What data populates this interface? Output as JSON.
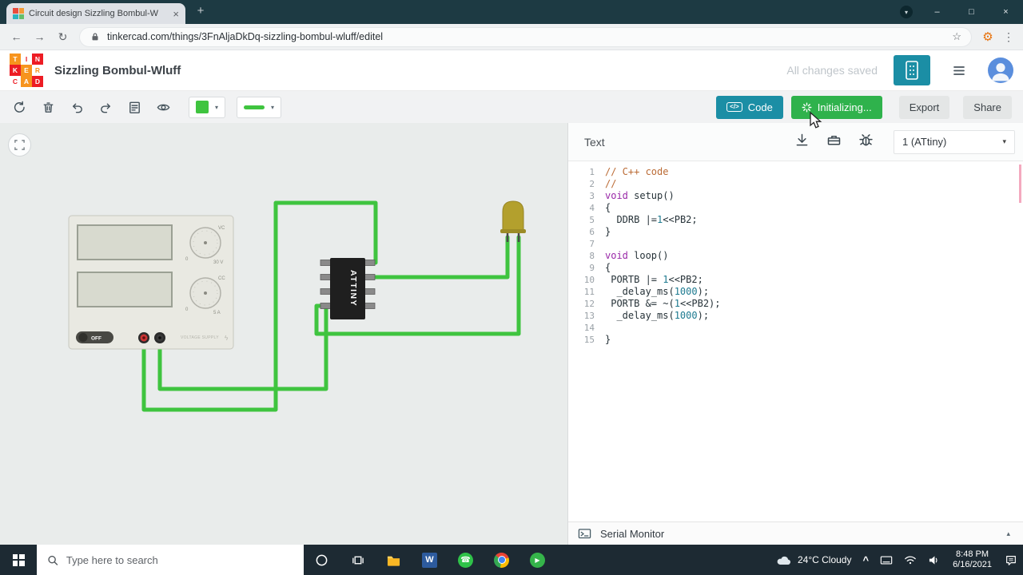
{
  "colors": {
    "accent_teal": "#1b8ea5",
    "run_green": "#2fb24c",
    "wire_green": "#3fc43f",
    "titlebar_bg": "#1d3a43",
    "taskbar_bg": "#1d2a33"
  },
  "glyphs": {
    "caret_down": "▾",
    "caret_up": "▴",
    "close": "×",
    "plus": "+",
    "minimize": "–",
    "maximize": "□",
    "back": "←",
    "forward": "→",
    "reload": "↻",
    "star": "☆",
    "gear": "⚙",
    "menu_dots": "⋮",
    "chevron": "^",
    "phone": "☎",
    "play": "▶",
    "bolt": "ϟ",
    "code_tag": "</>"
  },
  "browser": {
    "tab_title": "Circuit design Sizzling Bombul-W",
    "url": "tinkercad.com/things/3FnAljaDkDq-sizzling-bombul-wluff/editel"
  },
  "header": {
    "logo_cells": [
      {
        "ch": "T",
        "bg": "#f7941e",
        "fg": "#ffffff"
      },
      {
        "ch": "I",
        "bg": "#ffffff",
        "fg": "#ed1c24"
      },
      {
        "ch": "N",
        "bg": "#ed1c24",
        "fg": "#ffffff"
      },
      {
        "ch": "K",
        "bg": "#ed1c24",
        "fg": "#ffffff"
      },
      {
        "ch": "E",
        "bg": "#f7941e",
        "fg": "#ffffff"
      },
      {
        "ch": "R",
        "bg": "#ffffff",
        "fg": "#f7941e"
      },
      {
        "ch": "C",
        "bg": "#ffffff",
        "fg": "#ed1c24"
      },
      {
        "ch": "A",
        "bg": "#f7941e",
        "fg": "#ffffff"
      },
      {
        "ch": "D",
        "bg": "#ed1c24",
        "fg": "#ffffff"
      }
    ],
    "title": "Sizzling Bombul-Wluff",
    "status": "All changes saved"
  },
  "toolbar": {
    "code": "Code",
    "run": "Initializing...",
    "export": "Export",
    "share": "Share"
  },
  "canvas": {
    "chip": "ATTINY",
    "psu": {
      "off": "OFF",
      "vc": "VC",
      "cc": "CC",
      "v_max": "30 V",
      "a_max": "5 A",
      "zero": "0",
      "brand": "VOLTAGE SUPPLY"
    }
  },
  "code_panel": {
    "mode": "Text",
    "board": "1 (ATtiny)",
    "serial": "Serial Monitor",
    "lines": [
      "// C++ code",
      "//",
      "void setup()",
      "{",
      "  DDRB |=1<<PB2;",
      "}",
      "",
      "void loop()",
      "{",
      " PORTB |= 1<<PB2;",
      "  _delay_ms(1000);",
      " PORTB &= ~(1<<PB2);",
      "  _delay_ms(1000);",
      "",
      "}"
    ]
  },
  "taskbar": {
    "search": "Type here to search",
    "word_letter": "W",
    "weather": "24°C Cloudy",
    "time": "8:48 PM",
    "date": "6/16/2021"
  }
}
